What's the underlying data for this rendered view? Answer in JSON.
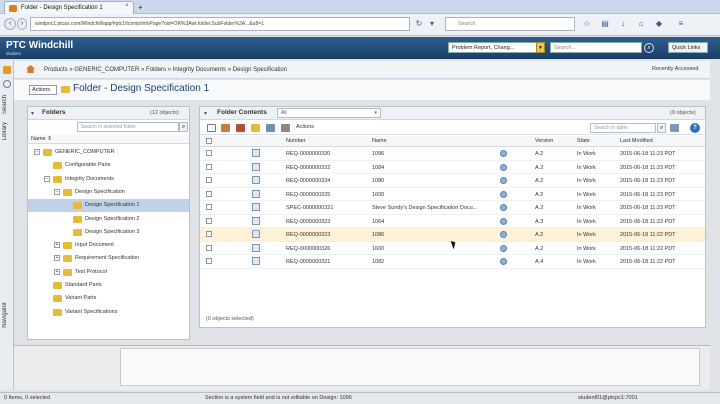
{
  "browser": {
    "tab_title": "Folder - Design Specification 1",
    "url": "windpnc1.ptcas.com/Windchill/app/#ptc1/tcomp/infoPage?oid=OR%3Awt.folder.SubFolder%3A...&u8=1",
    "search_placeholder": "Search",
    "icons": [
      "star-icon",
      "clipboard-icon",
      "download-icon",
      "home-icon",
      "shield-icon",
      "menu-icon"
    ]
  },
  "header": {
    "logo": "PTC Windchill",
    "logo_sub": "student",
    "type_select": "Problem Report, Chang...",
    "search_placeholder": "Search...",
    "quick_links": "Quick Links"
  },
  "rail": {
    "search_label": "Search",
    "library_label": "Library",
    "navigator_label": "Navigator"
  },
  "breadcrumb": {
    "text": "Products  »  GENERIC_COMPUTER  »  Folders  »  Integrity Documents  »  Design Specification",
    "recently": "Recently Accessed"
  },
  "title": {
    "actions": "Actions",
    "page_title": "Folder - Design Specification 1"
  },
  "folders": {
    "title": "Folders",
    "count": "(12 objects)",
    "search_placeholder": "Search in selected folder",
    "column_name": "Name",
    "tree": [
      {
        "label": "GENERIC_COMPUTER",
        "indent": 0,
        "exp": "−"
      },
      {
        "label": "Configurable Parts",
        "indent": 1,
        "exp": ""
      },
      {
        "label": "Integrity Documents",
        "indent": 1,
        "exp": "−"
      },
      {
        "label": "Design Specification",
        "indent": 2,
        "exp": "−"
      },
      {
        "label": "Design Specification 1",
        "indent": 3,
        "exp": "",
        "selected": true
      },
      {
        "label": "Design Specification 2",
        "indent": 3,
        "exp": ""
      },
      {
        "label": "Design Specification 3",
        "indent": 3,
        "exp": ""
      },
      {
        "label": "Input Document",
        "indent": 2,
        "exp": "+"
      },
      {
        "label": "Requirement Specification",
        "indent": 2,
        "exp": "+"
      },
      {
        "label": "Test Protocol",
        "indent": 2,
        "exp": "+"
      },
      {
        "label": "Standard Parts",
        "indent": 1,
        "exp": ""
      },
      {
        "label": "Variant Parts",
        "indent": 1,
        "exp": ""
      },
      {
        "label": "Variant Specifications",
        "indent": 1,
        "exp": ""
      }
    ]
  },
  "contents": {
    "title": "Folder Contents",
    "view": "All",
    "count": "(9 objects)",
    "actions": "Actions",
    "search_placeholder": "Search in table",
    "columns": [
      "Number",
      "Name",
      "Version",
      "State",
      "Last Modified"
    ],
    "rows": [
      {
        "number": "REQ-0000000320",
        "name": "1096",
        "version": "A.2",
        "state": "In Work",
        "modified": "2015-06-18 11:23 PDT"
      },
      {
        "number": "REQ-0000000322",
        "name": "1084",
        "version": "A.2",
        "state": "In Work",
        "modified": "2015-06-18 11:23 PDT"
      },
      {
        "number": "REQ-0000000324",
        "name": "1080",
        "version": "A.2",
        "state": "In Work",
        "modified": "2015-06-18 11:23 PDT"
      },
      {
        "number": "REQ-0000000325",
        "name": "1600",
        "version": "A.2",
        "state": "In Work",
        "modified": "2015-06-18 11:23 PDT"
      },
      {
        "number": "SPEC-0000000321",
        "name": "Steve Sundy's Design Specification Docu...",
        "version": "A.2",
        "state": "In Work",
        "modified": "2015-06-18 11:23 PDT"
      },
      {
        "number": "REQ-0000000323",
        "name": "1064",
        "version": "A.3",
        "state": "In Work",
        "modified": "2015-06-18 11:23 PDT"
      },
      {
        "number": "REQ-0000000323",
        "name": "1086",
        "version": "A.2",
        "state": "In Work",
        "modified": "2015-06-18 11:22 PDT",
        "highlight": true
      },
      {
        "number": "REQ-0000000326",
        "name": "1600",
        "version": "A.2",
        "state": "In Work",
        "modified": "2015-06-18 11:22 PDT"
      },
      {
        "number": "REQ-0000000321",
        "name": "1082",
        "version": "A.4",
        "state": "In Work",
        "modified": "2015-06-18 11:22 PDT"
      }
    ],
    "selection_status": "(0 objects selected)"
  },
  "status": {
    "left": "0 Items, 0 selected",
    "middle": "Section is a system field and is not editable on Design: 1096",
    "right": "student01@ptcpc1:7001"
  },
  "colors": {
    "header": "#1b3f66",
    "selected_row": "#bfd2e8",
    "highlight_row": "#fdf1d8",
    "folder": "#e9b93a"
  }
}
